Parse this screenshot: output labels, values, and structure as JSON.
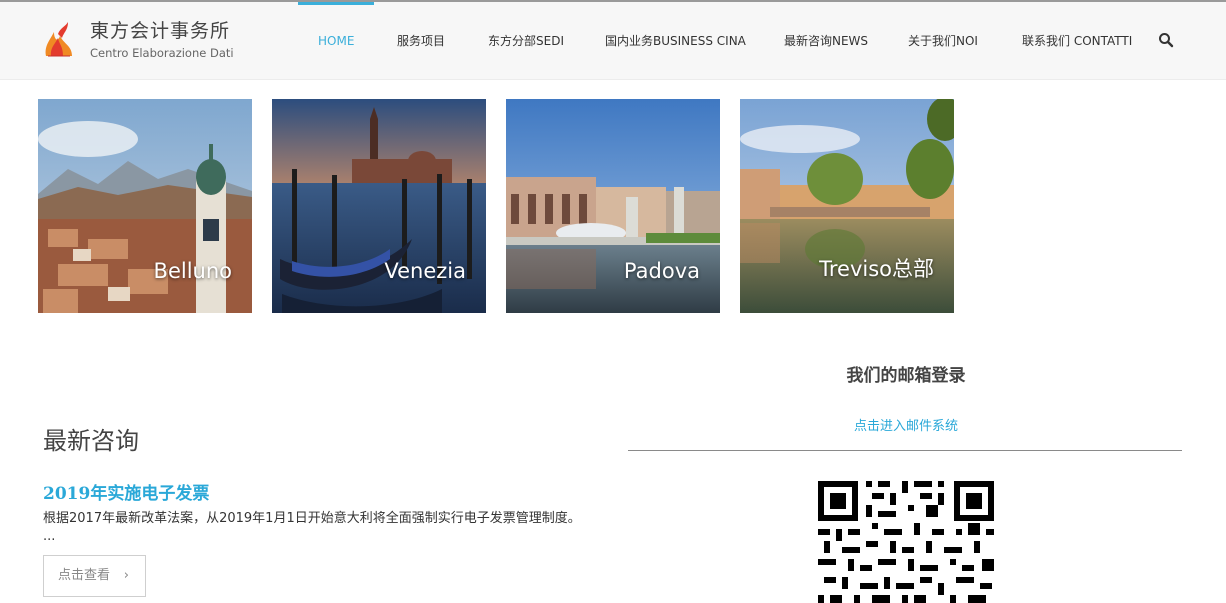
{
  "header": {
    "brand_title": "東方会计事务所",
    "brand_subtitle": "Centro Elaborazione Dati",
    "nav": [
      {
        "label": "HOME",
        "active": true
      },
      {
        "label": "服务项目"
      },
      {
        "label": "东方分部SEDI"
      },
      {
        "label": "国内业务BUSINESS CINA"
      },
      {
        "label": "最新咨询NEWS"
      },
      {
        "label": "关于我们NOI"
      },
      {
        "label": "联系我们 CONTATTI"
      }
    ],
    "search_icon": "search-icon"
  },
  "cities": [
    {
      "label": "Belluno"
    },
    {
      "label": "Venezia"
    },
    {
      "label": "Padova"
    },
    {
      "label": "Treviso总部"
    }
  ],
  "news": {
    "heading": "最新咨询",
    "title": "2019年实施电子发票",
    "excerpt": "根据2017年最新改革法案，从2019年1月1日开始意大利将全面强制实行电子发票管理制度。 ...",
    "read_more": "点击查看",
    "read_more_icon": "chevron-right-icon"
  },
  "mail": {
    "heading": "我们的邮箱登录",
    "link": "点击进入邮件系统"
  },
  "colors": {
    "accent": "#3bafda",
    "link": "#2aa8d8"
  }
}
